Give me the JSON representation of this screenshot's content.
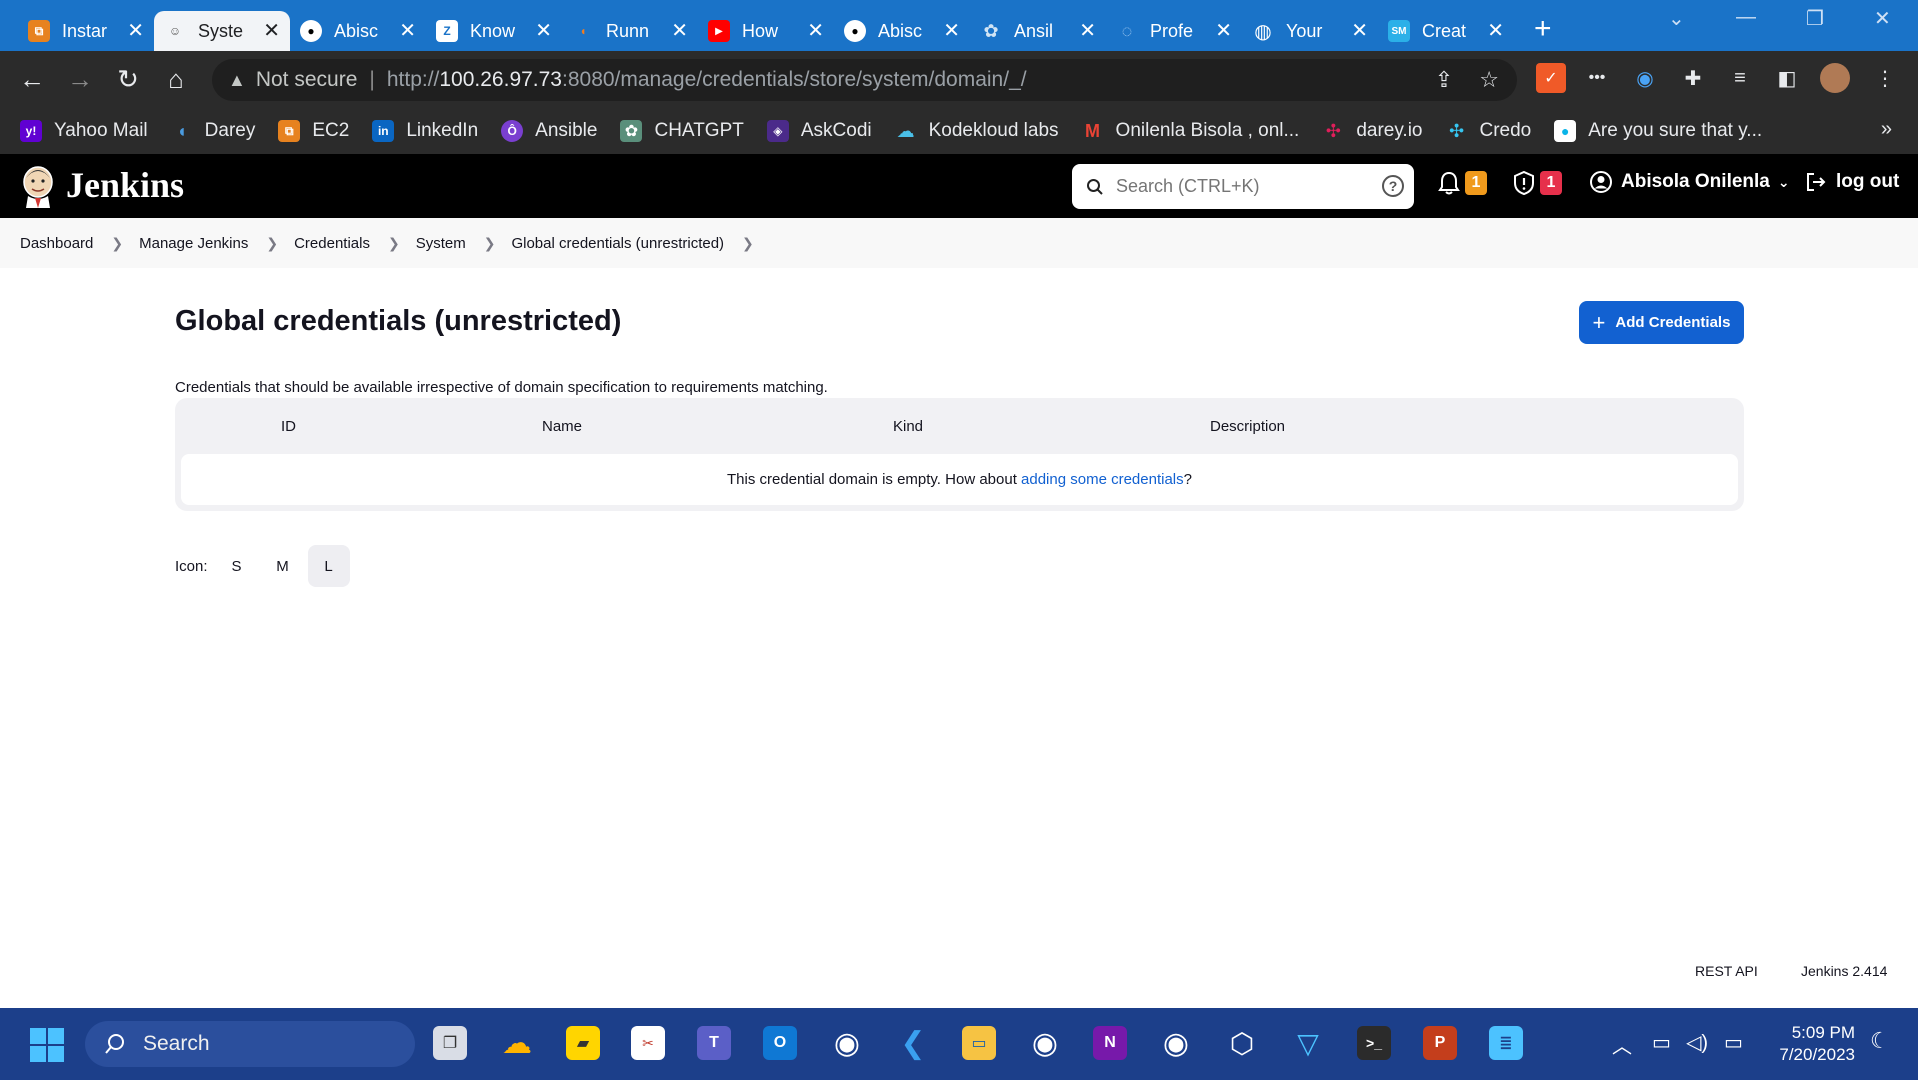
{
  "browser": {
    "tabs": [
      {
        "title": "Instar",
        "icon": "aws-ec2-icon",
        "color": "#e7821f",
        "glyph": "⧉"
      },
      {
        "title": "Syste",
        "icon": "jenkins-icon",
        "color": "#d8d8d8",
        "glyph": "☺"
      },
      {
        "title": "Abisc",
        "icon": "github-icon",
        "color": "#ffffff",
        "glyph": "●"
      },
      {
        "title": "Know",
        "icon": "z-icon",
        "color": "#1a73c8",
        "glyph": "Z"
      },
      {
        "title": "Runn",
        "icon": "darey-icon",
        "color": "#f07c21",
        "glyph": "◖"
      },
      {
        "title": "How",
        "icon": "youtube-icon",
        "color": "#ff0000",
        "glyph": "▶"
      },
      {
        "title": "Abisc",
        "icon": "github-icon",
        "color": "#ffffff",
        "glyph": "●"
      },
      {
        "title": "Ansil",
        "icon": "chatgpt-icon",
        "color": "#a9c6e0",
        "glyph": "✿"
      },
      {
        "title": "Profe",
        "icon": "profile-icon",
        "color": "#4a9be0",
        "glyph": "◌"
      },
      {
        "title": "Your",
        "icon": "globe-icon",
        "color": "#ffffff",
        "glyph": "◍"
      },
      {
        "title": "Creat",
        "icon": "sm-icon",
        "color": "#2bb0e8",
        "glyph": "SM"
      }
    ],
    "address": {
      "not_secure": "Not secure",
      "url_scheme": "http://",
      "url_host": "100.26.97.73",
      "url_rest": ":8080/manage/credentials/store/system/domain/_/"
    },
    "bookmarks": [
      {
        "label": "Yahoo Mail",
        "icon": "yahoo-icon",
        "color": "#6001d2",
        "glyph": "y!"
      },
      {
        "label": "Darey",
        "icon": "darey-icon",
        "color": "#1a73c8",
        "glyph": "◖"
      },
      {
        "label": "EC2",
        "icon": "aws-ec2-icon",
        "color": "#e7821f",
        "glyph": "⧉"
      },
      {
        "label": "LinkedIn",
        "icon": "linkedin-icon",
        "color": "#0a66c2",
        "glyph": "in"
      },
      {
        "label": "Ansible",
        "icon": "ansible-icon",
        "color": "#7a3fd0",
        "glyph": "Ô"
      },
      {
        "label": "CHATGPT",
        "icon": "chatgpt-icon",
        "color": "#5a8f7b",
        "glyph": "✿"
      },
      {
        "label": "AskCodi",
        "icon": "askcodi-icon",
        "color": "#4b2a8a",
        "glyph": "◈"
      },
      {
        "label": "Kodekloud labs",
        "icon": "kodekloud-icon",
        "color": "#2b2b2b",
        "glyph": "☁"
      },
      {
        "label": "Onilenla Bisola , onl...",
        "icon": "gmail-icon",
        "color": "#2b2b2b",
        "glyph": "M"
      },
      {
        "label": "darey.io",
        "icon": "slack-icon",
        "color": "#2b2b2b",
        "glyph": "✣"
      },
      {
        "label": "Credo",
        "icon": "slack-icon",
        "color": "#2b2b2b",
        "glyph": "✣"
      },
      {
        "label": "Are you sure that y...",
        "icon": "dot-icon",
        "color": "#000000",
        "glyph": "●"
      }
    ]
  },
  "jenkins": {
    "brand": "Jenkins",
    "search_placeholder": "Search (CTRL+K)",
    "notifications_count": "1",
    "security_count": "1",
    "user_name": "Abisola Onilenla",
    "logout_label": "log out",
    "breadcrumbs": [
      "Dashboard",
      "Manage Jenkins",
      "Credentials",
      "System",
      "Global credentials (unrestricted)"
    ],
    "page_title": "Global credentials (unrestricted)",
    "add_button_label": "Add Credentials",
    "description": "Credentials that should be available irrespective of domain specification to requirements matching.",
    "table": {
      "columns": [
        "ID",
        "Name",
        "Kind",
        "Description"
      ],
      "empty_text_prefix": "This credential domain is empty. How about ",
      "empty_link": "adding some credentials",
      "empty_text_suffix": "?"
    },
    "icon_size_label": "Icon:",
    "icon_sizes": [
      "S",
      "M",
      "L"
    ],
    "icon_size_selected": "L",
    "footer": {
      "rest_api": "REST API",
      "version": "Jenkins 2.414"
    }
  },
  "taskbar": {
    "search_label": "Search",
    "time": "5:09 PM",
    "date": "7/20/2023"
  }
}
